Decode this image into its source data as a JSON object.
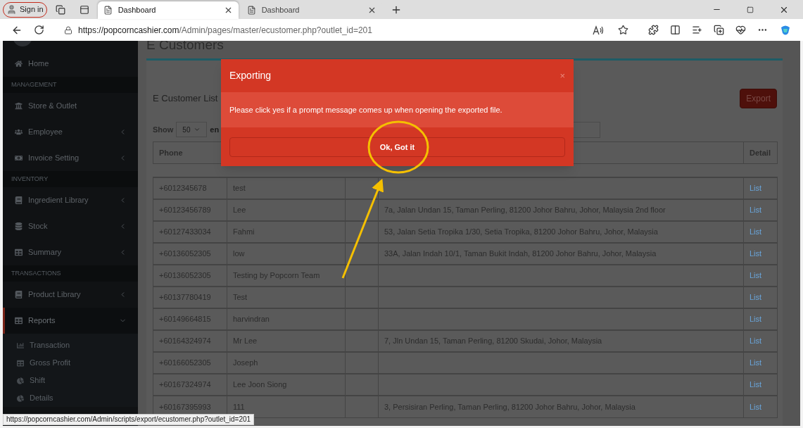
{
  "browser": {
    "profile": "Sign in",
    "tabs": [
      {
        "title": "Dashboard",
        "selected": true
      },
      {
        "title": "Dashboard",
        "selected": false
      }
    ],
    "url_host": "https://popcorncashier.com",
    "url_path": "/Admin/pages/master/ecustomer.php?outlet_id=201"
  },
  "sidebar": {
    "items": [
      {
        "kind": "item",
        "label": "Home",
        "selected": false
      },
      {
        "kind": "section",
        "label": "MANAGEMENT"
      },
      {
        "kind": "item",
        "label": "Store & Outlet",
        "selected": false
      },
      {
        "kind": "item",
        "label": "Employee",
        "selected": false,
        "expandable": true,
        "expanded": false
      },
      {
        "kind": "item",
        "label": "Invoice Setting",
        "selected": false,
        "expandable": true,
        "expanded": false
      },
      {
        "kind": "section",
        "label": "INVENTORY"
      },
      {
        "kind": "item",
        "label": "Ingredient Library",
        "selected": false,
        "expandable": true,
        "expanded": false
      },
      {
        "kind": "item",
        "label": "Stock",
        "selected": false,
        "expandable": true,
        "expanded": false
      },
      {
        "kind": "item",
        "label": "Summary",
        "selected": false,
        "expandable": true,
        "expanded": false
      },
      {
        "kind": "section",
        "label": "TRANSACTIONS"
      },
      {
        "kind": "item",
        "label": "Product Library",
        "selected": false,
        "expandable": true,
        "expanded": false
      },
      {
        "kind": "item",
        "label": "Reports",
        "selected": true,
        "expandable": true,
        "expanded": true,
        "children": [
          {
            "label": "Transaction"
          },
          {
            "label": "Gross Profit"
          },
          {
            "label": "Shift"
          },
          {
            "label": "Details"
          }
        ]
      }
    ]
  },
  "main": {
    "title": "E Customers",
    "card_title": "E Customer List",
    "export_button": "Export",
    "show_label": "Show",
    "page_size": "50",
    "entries_label": "en",
    "columns": [
      {
        "label": "Phone"
      },
      {
        "label": "Detail"
      }
    ],
    "rows": [
      {
        "phone": "+6012345678",
        "name": "test",
        "detail": "List"
      },
      {
        "phone": "+60123456789",
        "name": "Lee",
        "address": "7a, Jalan Undan 15, Taman Perling, 81200 Johor Bahru, Johor, Malaysia 2nd floor",
        "detail": "List"
      },
      {
        "phone": "+60127433034",
        "name": "Fahmi",
        "address": "53, Jalan Setia Tropika 1/30, Setia Tropika, 81200 Johor Bahru, Johor, Malaysia",
        "detail": "List"
      },
      {
        "phone": "+60136052305",
        "name": "low",
        "address": "33A, Jalan Indah 10/1, Taman Bukit Indah, 81200 Johor Bahru, Johor, Malaysia",
        "detail": "List"
      },
      {
        "phone": "+60136052305",
        "name": "Testing by Popcorn Team",
        "detail": "List"
      },
      {
        "phone": "+60137780419",
        "name": "Test",
        "detail": "List"
      },
      {
        "phone": "+60149664815",
        "name": "harvindran",
        "detail": "List"
      },
      {
        "phone": "+60164324974",
        "name": "Mr Lee",
        "address": "7, Jln Undan 15, Taman Perling, 81200 Skudai, Johor, Malaysia",
        "detail": "List"
      },
      {
        "phone": "+60166052305",
        "name": "Joseph",
        "detail": "List"
      },
      {
        "phone": "+60167324974",
        "name": "Lee Joon Siong",
        "detail": "List"
      },
      {
        "phone": "+60167395993",
        "name": "111",
        "address": "3, Persisiran Perling, Taman Perling, 81200 Johor Bahru, Johor, Malaysia",
        "detail": "List"
      }
    ]
  },
  "modal": {
    "title": "Exporting",
    "close": "×",
    "message": "Please click yes if a prompt message comes up when opening the exported file.",
    "button": "Ok, Got it"
  },
  "status_url": "https://popcorncashier.com/Admin/scripts/export/ecustomer.php?outlet_id=201"
}
